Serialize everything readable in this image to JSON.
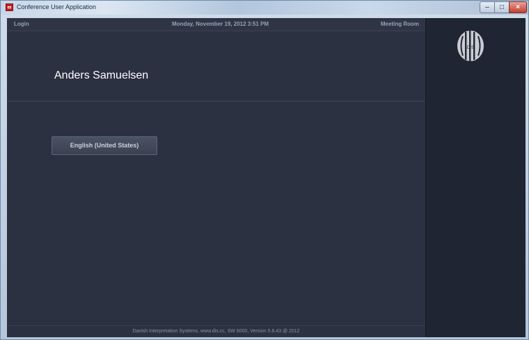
{
  "window": {
    "title": "Conference User Application"
  },
  "topbar": {
    "left": "Login",
    "center": "Monday, November 19, 2012 3:51 PM",
    "right": "Meeting Room"
  },
  "user": {
    "name": "Anders Samuelsen"
  },
  "language_button": {
    "label": "English (United States)"
  },
  "footer": {
    "text": "Danish Interpretation Systems, www.dis.cc, SW 6000, Version 5.8.43 @ 2012"
  },
  "logo": {
    "text": "DIS"
  },
  "colors": {
    "background": "#2b3140",
    "right_panel": "#1f2533",
    "text": "#ffffff",
    "titlebar": "#c7d6e8",
    "close_button": "#c2402e"
  }
}
